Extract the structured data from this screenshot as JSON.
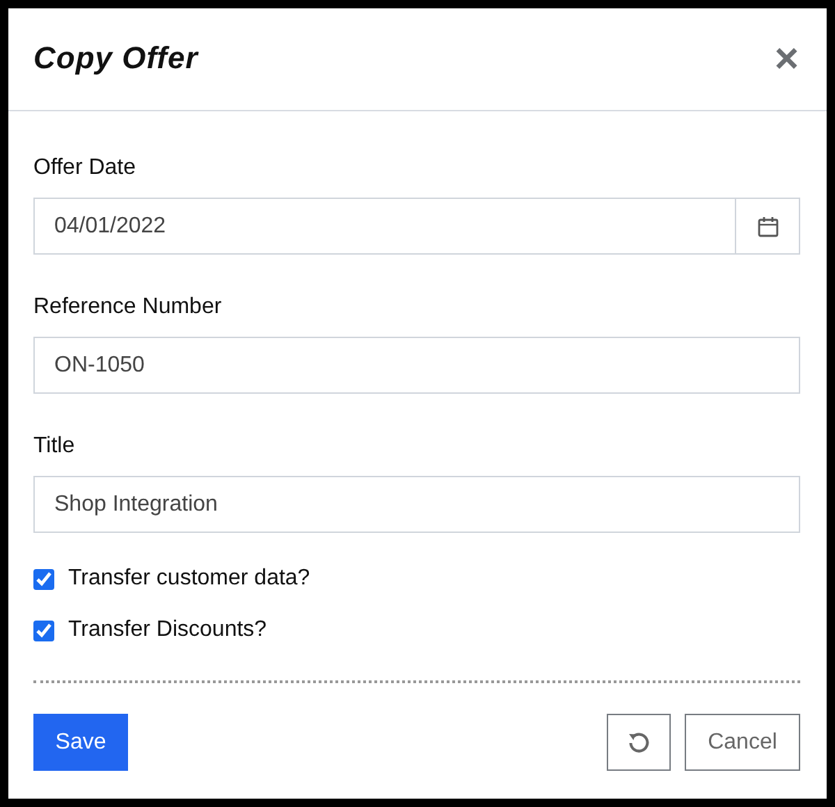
{
  "dialog": {
    "title": "Copy Offer",
    "close": "×"
  },
  "fields": [
    {
      "label": "Offer Date",
      "value": "04/01/2022",
      "kind": "date"
    },
    {
      "label": "Reference Number",
      "value": "ON-1050",
      "kind": "text"
    },
    {
      "label": "Title",
      "value": "Shop Integration",
      "kind": "text"
    }
  ],
  "checkboxes": [
    {
      "label": "Transfer customer data?",
      "checked": true
    },
    {
      "label": "Transfer Discounts?",
      "checked": true
    }
  ],
  "buttons": {
    "save": "Save",
    "cancel": "Cancel"
  }
}
